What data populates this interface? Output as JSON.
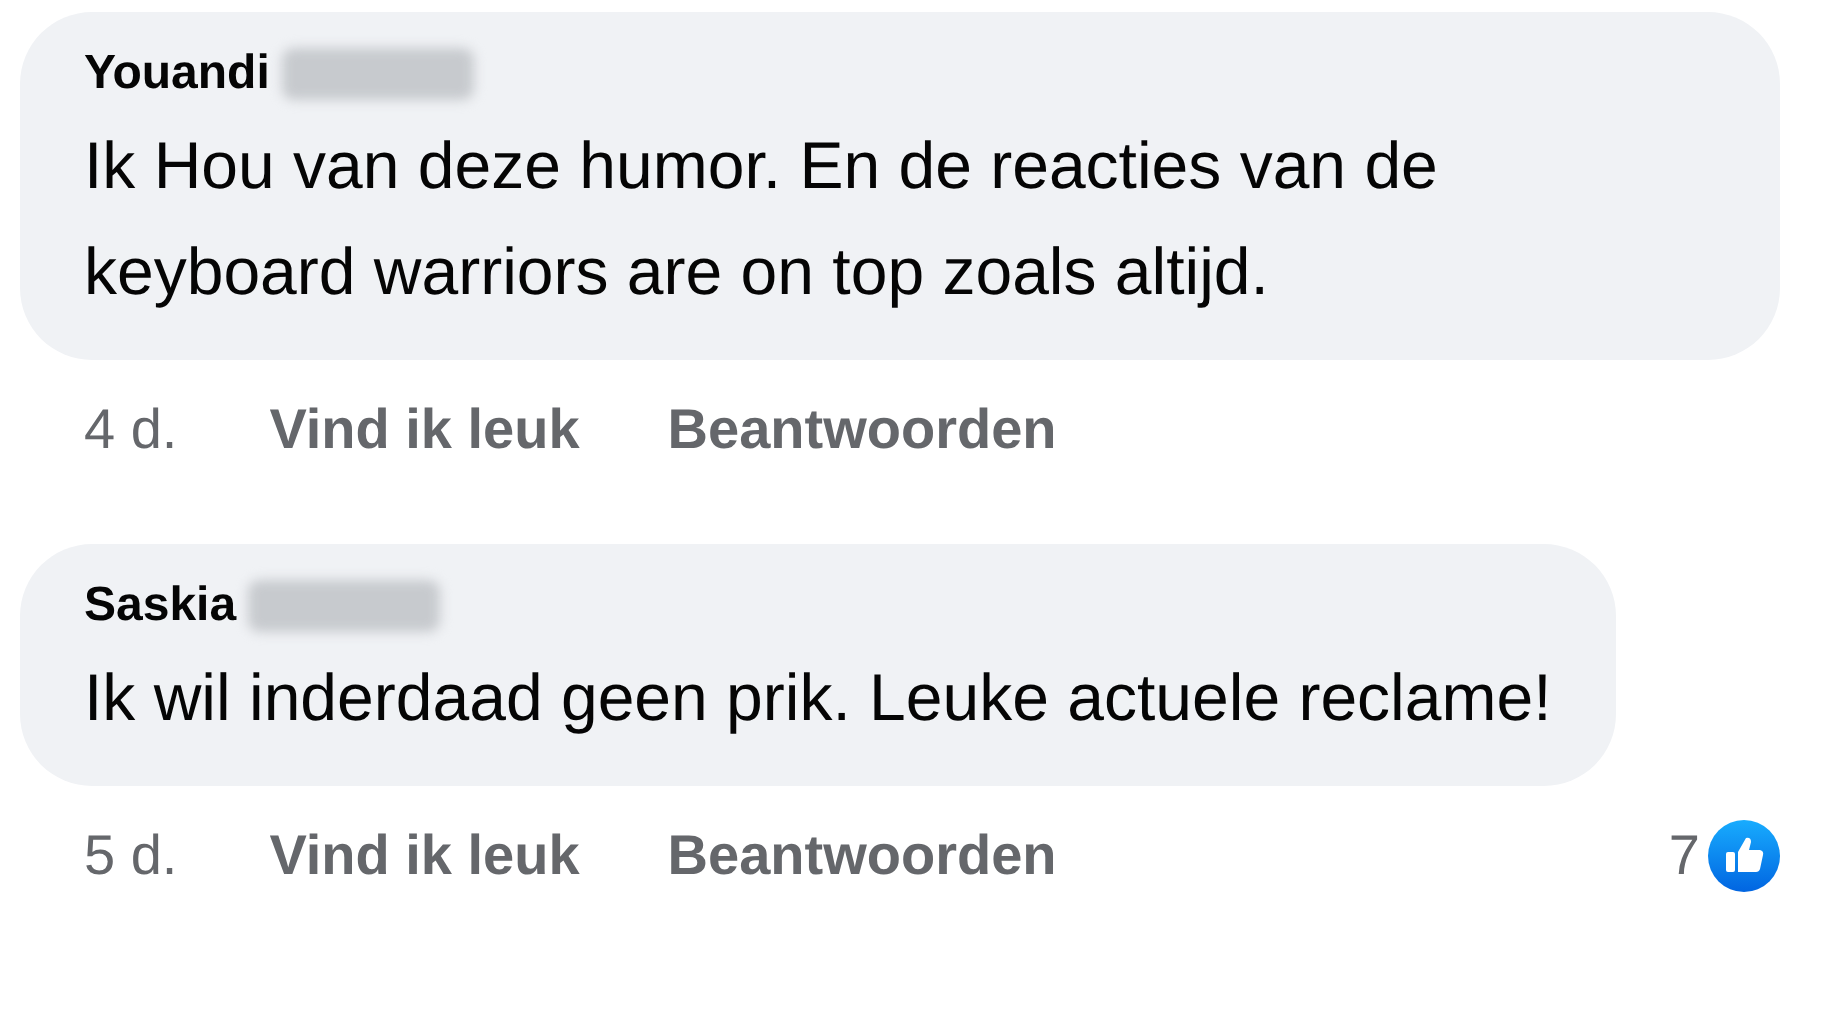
{
  "comments": [
    {
      "author": "Youandi",
      "author_blurred": true,
      "text": "Ik Hou van deze humor. En de reacties van de keyboard warriors are on top zoals altijd.",
      "time": "4 d.",
      "actions": [
        "Vind ik leuk",
        "Beantwoorden"
      ]
    },
    {
      "author": "Saskia",
      "author_blurred": true,
      "text": "Ik wil inderdaad geen prik. Leuke actuele reclame!",
      "time": "5 d.",
      "actions": [
        "Vind ik leuk",
        "Beantwoorden"
      ],
      "reactions": {
        "count": "7"
      }
    }
  ]
}
